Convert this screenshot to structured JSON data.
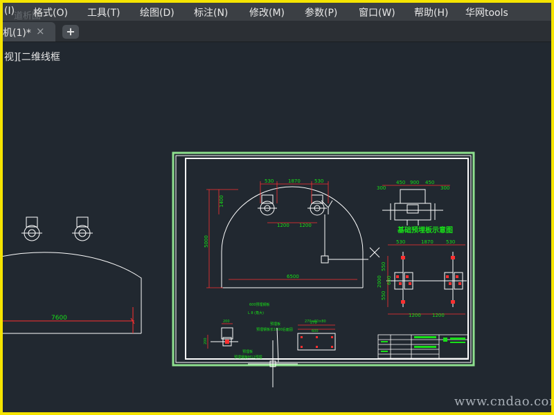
{
  "menu": {
    "items": [
      "(I)",
      "格式(O)",
      "工具(T)",
      "绘图(D)",
      "标注(N)",
      "修改(M)",
      "参数(P)",
      "窗口(W)",
      "帮助(H)",
      "华网tools"
    ]
  },
  "tabs": {
    "ghost_label": "道析图",
    "doc_tab_label": "机(1)*",
    "close_glyph": "×",
    "new_tab_glyph": "+"
  },
  "viewport": {
    "label": "视][二维线框"
  },
  "drawing": {
    "left_arch_dim": "7600",
    "arch_dims": [
      "530",
      "1870",
      "530",
      "1200",
      "1200",
      "1400",
      "5000",
      "6500"
    ],
    "base_section_dims": [
      "300",
      "450",
      "900",
      "450",
      "300"
    ],
    "base_title": "基础预埋板示意图",
    "base_plan_dims": [
      "530",
      "1870",
      "530",
      "1200",
      "1200",
      "550",
      "600",
      "2000",
      "550"
    ],
    "notes": [
      "600预埋钢板",
      "L 8 (角大)",
      "预埋板",
      "预埋钢板长1000后面固",
      "预埋板",
      "预埋钢板M12预埋"
    ],
    "detail_dims": [
      "200",
      "270",
      "200",
      "600",
      "270×60×80"
    ]
  },
  "colors": {
    "frame": "#f5e400",
    "canvas": "#212830",
    "menubar": "#3b3f44",
    "cad_white": "#ffffff",
    "cad_green": "#18e018",
    "cad_red": "#ff3030",
    "border_highlight": "#8ee08e"
  },
  "watermark": "www.cndao.com"
}
